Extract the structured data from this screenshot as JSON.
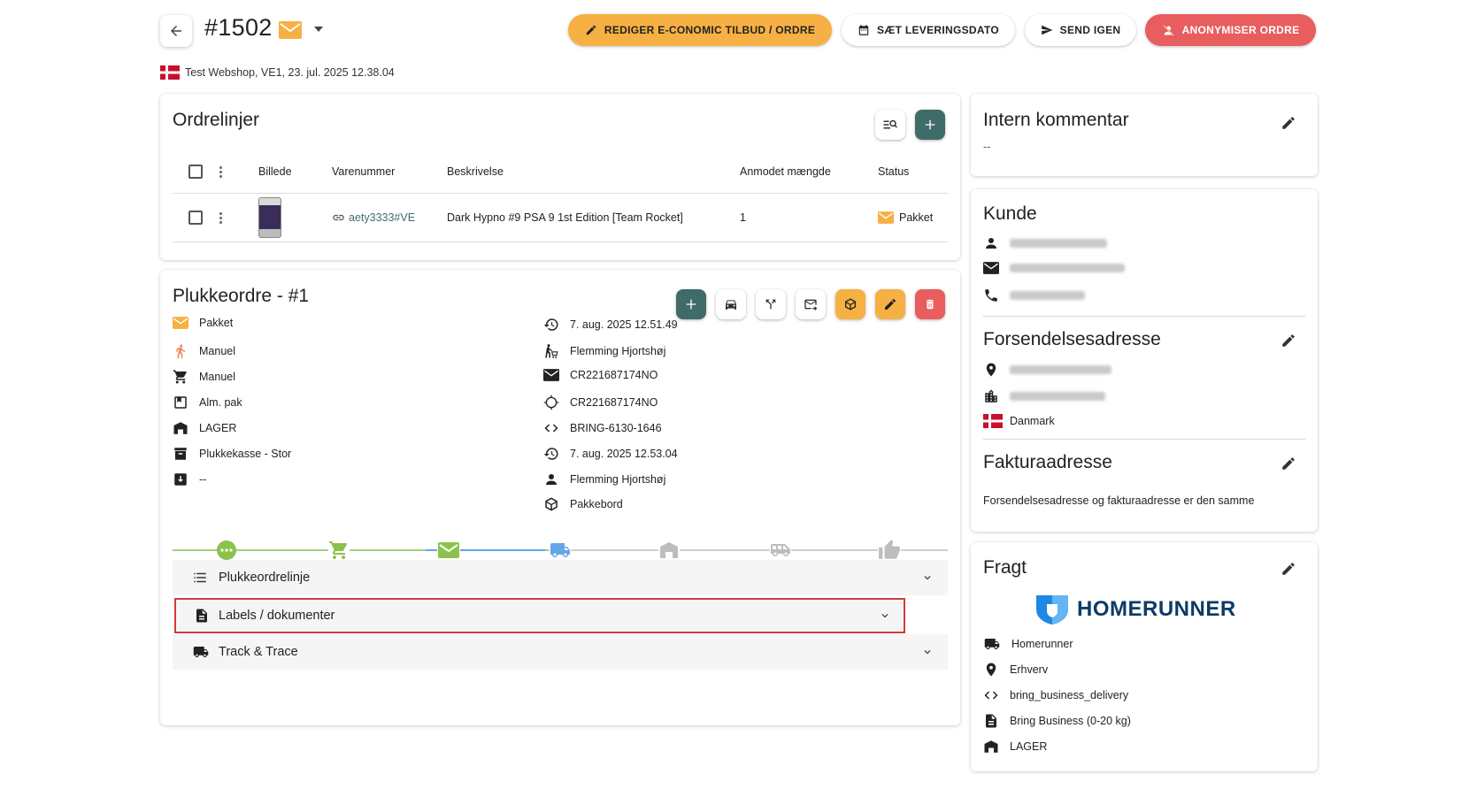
{
  "header": {
    "order_number": "#1502",
    "subtitle": "Test Webshop, VE1, 23. jul. 2025 12.38.04",
    "buttons": {
      "edit_economic": "REDIGER E-CONOMIC TILBUD / ORDRE",
      "set_delivery_date": "SÆT LEVERINGSDATO",
      "send_again": "SEND IGEN",
      "anonymize": "ANONYMISER ORDRE"
    }
  },
  "order_lines": {
    "title": "Ordrelinjer",
    "columns": [
      "Billede",
      "Varenummer",
      "Beskrivelse",
      "Anmodet mængde",
      "Status"
    ],
    "rows": [
      {
        "sku": "aety3333#VE",
        "description": "Dark Hypno #9 PSA 9 1st Edition [Team Rocket]",
        "quantity": "1",
        "status": "Pakket"
      }
    ]
  },
  "pick_order": {
    "title": "Plukkeordre - #1",
    "left_info": [
      {
        "icon": "envelope-icon",
        "text": "Pakket"
      },
      {
        "icon": "walking-person-icon",
        "text": "Manuel"
      },
      {
        "icon": "cart-icon",
        "text": "Manuel"
      },
      {
        "icon": "bookmark-box-icon",
        "text": "Alm. pak"
      },
      {
        "icon": "warehouse-icon",
        "text": "LAGER"
      },
      {
        "icon": "archive-box-icon",
        "text": "Plukkekasse - Stor"
      },
      {
        "icon": "download-box-icon",
        "text": "--"
      }
    ],
    "right_info": [
      {
        "icon": "history-icon",
        "text": "7. aug. 2025 12.51.49"
      },
      {
        "icon": "person-cart-icon",
        "text": "Flemming Hjortshøj"
      },
      {
        "icon": "envelope-icon",
        "text": "CR221687174NO"
      },
      {
        "icon": "crosshair-icon",
        "text": "CR221687174NO"
      },
      {
        "icon": "code-icon",
        "text": "BRING-6130-1646"
      },
      {
        "icon": "history-icon",
        "text": "7. aug. 2025 12.53.04"
      },
      {
        "icon": "person-icon",
        "text": "Flemming Hjortshøj"
      },
      {
        "icon": "package-icon",
        "text": "Pakkebord"
      }
    ],
    "progress_steps": [
      "dots",
      "cart",
      "envelope",
      "truck",
      "warehouse",
      "van",
      "thumbs-up"
    ],
    "accordions": [
      {
        "label": "Plukkeordrelinje"
      },
      {
        "label": "Labels / dokumenter"
      },
      {
        "label": "Track & Trace"
      }
    ]
  },
  "internal_comment": {
    "title": "Intern kommentar",
    "value": "--"
  },
  "customer": {
    "title": "Kunde"
  },
  "shipping_address": {
    "title": "Forsendelsesadresse",
    "country": "Danmark"
  },
  "billing_address": {
    "title": "Fakturaadresse",
    "note": "Forsendelsesadresse og fakturaadresse er den samme"
  },
  "freight": {
    "title": "Fragt",
    "logo_text": "HOMERUNNER",
    "items": [
      {
        "icon": "truck-icon",
        "text": "Homerunner"
      },
      {
        "icon": "location-pin-icon",
        "text": "Erhverv"
      },
      {
        "icon": "code-icon",
        "text": "bring_business_delivery"
      },
      {
        "icon": "document-icon",
        "text": "Bring Business (0-20 kg)"
      },
      {
        "icon": "warehouse-icon",
        "text": "LAGER"
      }
    ]
  },
  "colors": {
    "accent_yellow": "#f7b043",
    "danger_red": "#e85d5d",
    "teal": "#3f6b68",
    "progress_done": "#8bc34a",
    "progress_active": "#64a6e8",
    "progress_pending": "#bdbdbd",
    "link": "#3d6f6c"
  }
}
